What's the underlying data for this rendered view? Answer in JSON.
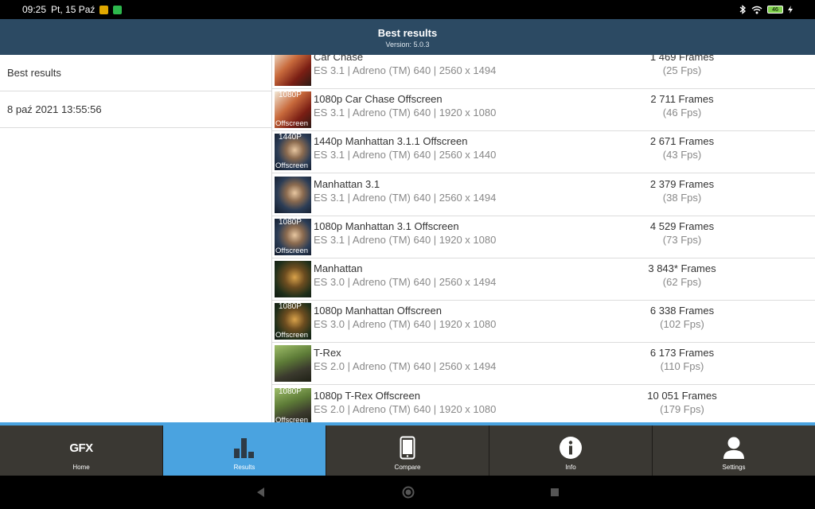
{
  "status_bar": {
    "time": "09:25",
    "date": "Pt, 15 Paź",
    "battery": "46"
  },
  "header": {
    "title": "Best results",
    "version": "Version: 5.0.3"
  },
  "left_panel": {
    "items": [
      {
        "label": "Best results"
      },
      {
        "label": "8 paź 2021 13:55:56"
      }
    ]
  },
  "results": [
    {
      "name": "Car Chase",
      "details": "ES 3.1 | Adreno (TM) 640 | 2560 x 1494",
      "frames": "1 469 Frames",
      "fps": "(25 Fps)",
      "thumb_top": "",
      "thumb_bottom": "",
      "thumb_theme": "car"
    },
    {
      "name": "1080p Car Chase Offscreen",
      "details": "ES 3.1 | Adreno (TM) 640 | 1920 x 1080",
      "frames": "2 711 Frames",
      "fps": "(46 Fps)",
      "thumb_top": "1080P",
      "thumb_bottom": "Offscreen",
      "thumb_theme": "car"
    },
    {
      "name": "1440p Manhattan 3.1.1 Offscreen",
      "details": "ES 3.1 | Adreno (TM) 640 | 2560 x 1440",
      "frames": "2 671 Frames",
      "fps": "(43 Fps)",
      "thumb_top": "1440P",
      "thumb_bottom": "Offscreen",
      "thumb_theme": "manhattan31"
    },
    {
      "name": "Manhattan 3.1",
      "details": "ES 3.1 | Adreno (TM) 640 | 2560 x 1494",
      "frames": "2 379 Frames",
      "fps": "(38 Fps)",
      "thumb_top": "",
      "thumb_bottom": "",
      "thumb_theme": "manhattan31"
    },
    {
      "name": "1080p Manhattan 3.1 Offscreen",
      "details": "ES 3.1 | Adreno (TM) 640 | 1920 x 1080",
      "frames": "4 529 Frames",
      "fps": "(73 Fps)",
      "thumb_top": "1080P",
      "thumb_bottom": "Offscreen",
      "thumb_theme": "manhattan31"
    },
    {
      "name": "Manhattan",
      "details": "ES 3.0 | Adreno (TM) 640 | 2560 x 1494",
      "frames": "3 843* Frames",
      "fps": "(62 Fps)",
      "thumb_top": "",
      "thumb_bottom": "",
      "thumb_theme": "manhattan"
    },
    {
      "name": "1080p Manhattan Offscreen",
      "details": "ES 3.0 | Adreno (TM) 640 | 1920 x 1080",
      "frames": "6 338 Frames",
      "fps": "(102 Fps)",
      "thumb_top": "1080P",
      "thumb_bottom": "Offscreen",
      "thumb_theme": "manhattan"
    },
    {
      "name": "T-Rex",
      "details": "ES 2.0 | Adreno (TM) 640 | 2560 x 1494",
      "frames": "6 173 Frames",
      "fps": "(110 Fps)",
      "thumb_top": "",
      "thumb_bottom": "",
      "thumb_theme": "trex"
    },
    {
      "name": "1080p T-Rex Offscreen",
      "details": "ES 2.0 | Adreno (TM) 640 | 1920 x 1080",
      "frames": "10 051 Frames",
      "fps": "(179 Fps)",
      "thumb_top": "1080P",
      "thumb_bottom": "Offscreen",
      "thumb_theme": "trex"
    }
  ],
  "tabs": [
    {
      "label": "Home",
      "icon": "gfx-logo-icon",
      "logo_text": "GFX",
      "active": false
    },
    {
      "label": "Results",
      "icon": "bar-chart-icon",
      "active": true
    },
    {
      "label": "Compare",
      "icon": "phone-icon",
      "active": false
    },
    {
      "label": "Info",
      "icon": "info-icon",
      "active": false
    },
    {
      "label": "Settings",
      "icon": "user-icon",
      "active": false
    }
  ],
  "colors": {
    "header_bg": "#2c4a63",
    "accent": "#4aa3e0",
    "tab_bg": "#3a3833"
  }
}
